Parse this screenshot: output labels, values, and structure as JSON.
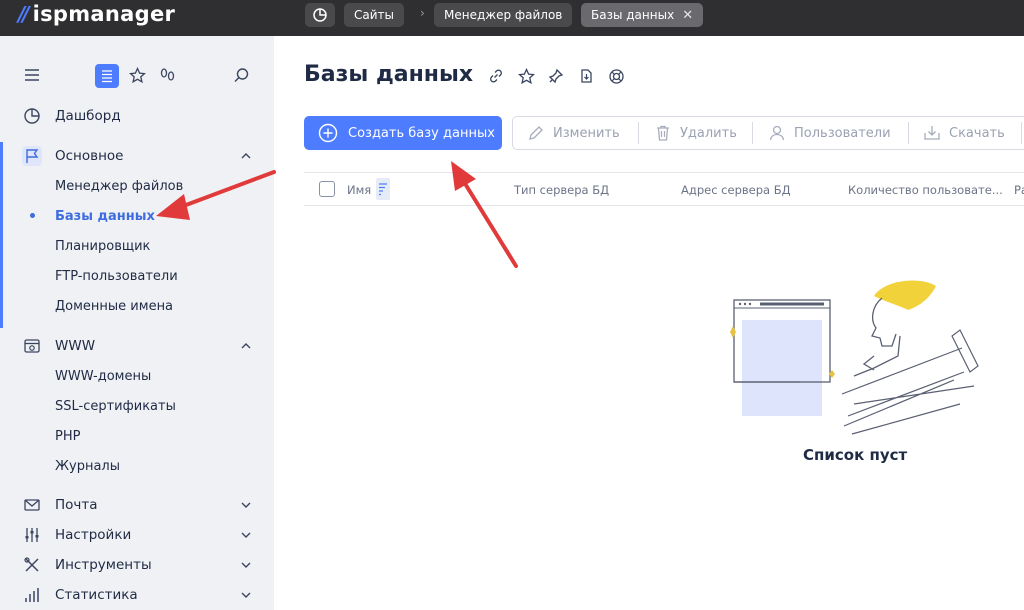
{
  "app": {
    "logo_text": "ispmanager"
  },
  "breadcrumbs": [
    {
      "label": "Сайты"
    },
    {
      "label": "Менеджер файлов"
    },
    {
      "label": "Базы данных"
    }
  ],
  "breadcrumb_close": "✕",
  "breadcrumb_separator": "›",
  "sidebar": {
    "items": [
      {
        "label": "Дашборд",
        "icon": "dashboard-icon"
      },
      {
        "label": "Основное",
        "icon": "flag-icon",
        "expanded": true,
        "children": [
          "Менеджер файлов",
          "Базы данных",
          "Планировщик",
          "FTP-пользователи",
          "Доменные имена"
        ],
        "active_child": "Базы данных"
      },
      {
        "label": "WWW",
        "icon": "www-icon",
        "expanded": true,
        "children": [
          "WWW-домены",
          "SSL-сертификаты",
          "PHP",
          "Журналы"
        ]
      },
      {
        "label": "Почта",
        "icon": "mail-icon",
        "expanded": false
      },
      {
        "label": "Настройки",
        "icon": "sliders-icon",
        "expanded": false
      },
      {
        "label": "Инструменты",
        "icon": "tools-icon",
        "expanded": false
      },
      {
        "label": "Статистика",
        "icon": "stats-icon",
        "expanded": false
      }
    ]
  },
  "main": {
    "title": "Базы данных",
    "create_button": "Создать базу данных",
    "toolbar": {
      "edit": "Изменить",
      "delete": "Удалить",
      "users": "Пользователи",
      "download": "Скачать"
    },
    "columns": [
      "Имя",
      "Тип сервера БД",
      "Адрес сервера БД",
      "Количество пользовате...",
      "Ра"
    ],
    "empty_text": "Список пуст"
  },
  "colors": {
    "accent": "#4d7cff",
    "topbar": "#2f2f31",
    "sidebar": "#f0f1f4",
    "annotation_arrow": "#e03a3a"
  }
}
